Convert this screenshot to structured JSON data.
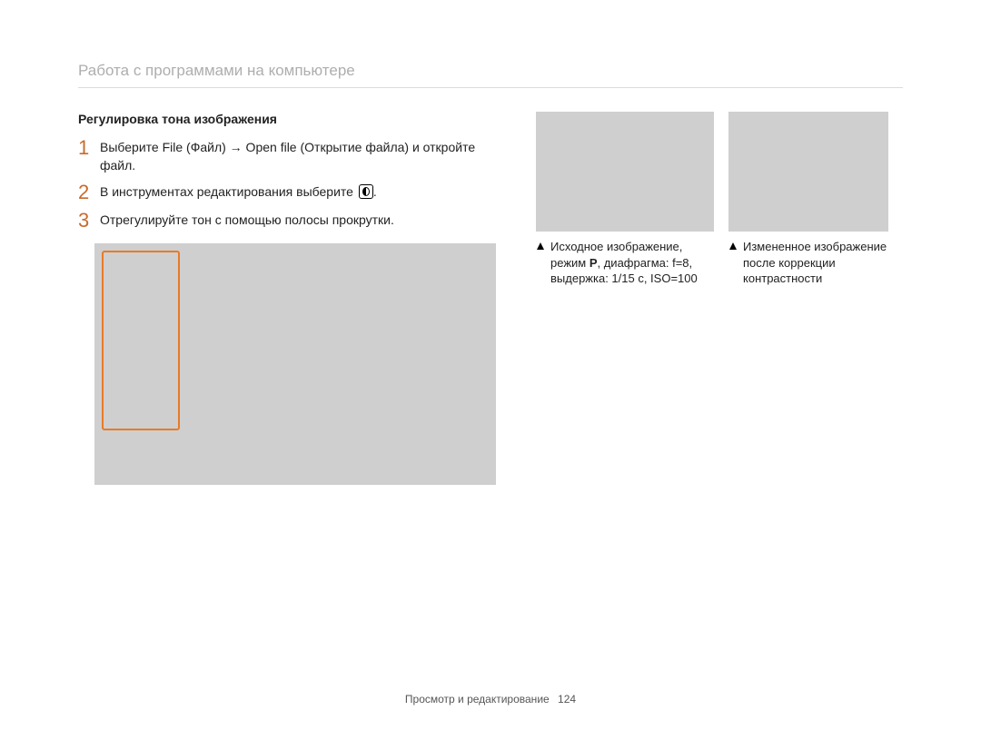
{
  "header": {
    "title": "Работа с программами на компьютере"
  },
  "section_heading": "Регулировка тона изображения",
  "steps": [
    "Выберите File (Файл) → Open ﬁle (Открытие файла) и откройте файл.",
    "В инструментах редактирования выберите ",
    "Отрегулируйте тон с помощью полосы прокрутки."
  ],
  "step2_icon_suffix": ".",
  "captions": {
    "left": {
      "line1": "Исходное изображение,",
      "line2_prefix": "режим ",
      "line2_mode": "P",
      "line2_suffix": ", диафрагма: f=8,",
      "line3": "выдержка: 1/15 с, ISO=100"
    },
    "right": {
      "line1": "Измененное изображение",
      "line2": "после коррекции",
      "line3": "контрастности"
    }
  },
  "footer": {
    "label": "Просмотр и редактирование",
    "page": "124"
  }
}
